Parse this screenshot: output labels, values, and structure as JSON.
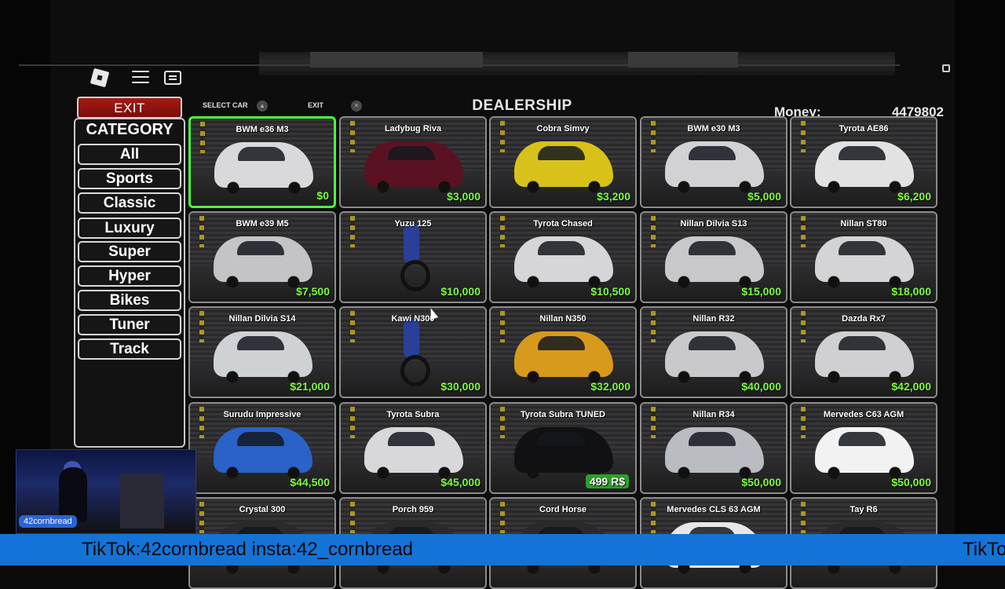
{
  "left_panel": {
    "exit_label": "EXIT",
    "category_title": "CATEGORY",
    "categories": [
      "All",
      "Sports",
      "Classic",
      "Luxury",
      "Super",
      "Hyper",
      "Bikes",
      "Tuner",
      "Track"
    ]
  },
  "header": {
    "select_car_label": "SELECT CAR",
    "exit_label": "EXIT",
    "title": "DEALERSHIP",
    "money_label": "Money:",
    "money_value": "4479802"
  },
  "cars": [
    {
      "name": "BWM e36 M3",
      "price": "$0",
      "color": "#d9d9dc",
      "selected": true
    },
    {
      "name": "Ladybug Riva",
      "price": "$3,000",
      "color": "#5a1222"
    },
    {
      "name": "Cobra Simvy",
      "price": "$3,200",
      "color": "#d8c21a"
    },
    {
      "name": "BWM e30 M3",
      "price": "$5,000",
      "color": "#d2d2d4"
    },
    {
      "name": "Tyrota AE86",
      "price": "$6,200",
      "color": "#e2e2e2"
    },
    {
      "name": "BWM e39 M5",
      "price": "$7,500",
      "color": "#c4c4c6"
    },
    {
      "name": "Yuzu 125",
      "price": "$10,000",
      "color": "#2a3f9a",
      "bike": true
    },
    {
      "name": "Tyrota Chased",
      "price": "$10,500",
      "color": "#d6d6d8"
    },
    {
      "name": "Nillan Dilvia S13",
      "price": "$15,000",
      "color": "#c8c8ca"
    },
    {
      "name": "Nillan ST80",
      "price": "$18,000",
      "color": "#d4d4d6"
    },
    {
      "name": "Nillan Dilvia S14",
      "price": "$21,000",
      "color": "#cfd2d4"
    },
    {
      "name": "Kawi N300",
      "price": "$30,000",
      "color": "#151517",
      "bike": true
    },
    {
      "name": "Nillan N350",
      "price": "$32,000",
      "color": "#d89a1c"
    },
    {
      "name": "Nillan R32",
      "price": "$40,000",
      "color": "#c9c9cb"
    },
    {
      "name": "Dazda Rx7",
      "price": "$42,000",
      "color": "#d0d0d2"
    },
    {
      "name": "Surudu Impressive",
      "price": "$44,500",
      "color": "#2a62c8"
    },
    {
      "name": "Tyrota Subra",
      "price": "$45,000",
      "color": "#d8d8da"
    },
    {
      "name": "Tyrota Subra TUNED",
      "price": "499 R$",
      "color": "#111113",
      "robux": true
    },
    {
      "name": "Nillan R34",
      "price": "$50,000",
      "color": "#b9bcc0"
    },
    {
      "name": "Mervedes C63 AGM",
      "price": "$50,000",
      "color": "#f2f2f2"
    },
    {
      "name": "Crystal 300",
      "price": "",
      "color": "#2a2a2c"
    },
    {
      "name": "Porch 959",
      "price": "",
      "color": "#2a2a2c"
    },
    {
      "name": "Cord Horse",
      "price": "",
      "color": "#2a2a2c"
    },
    {
      "name": "Mervedes CLS 63 AGM",
      "price": "",
      "color": "#e8e8e8"
    },
    {
      "name": "Tay R6",
      "price": "",
      "color": "#2a2a2c"
    }
  ],
  "stream": {
    "cam_name": "42cornbread",
    "banner": "TikTok:42cornbread insta:42_cornbread",
    "banner_repeat": "TikTok"
  }
}
